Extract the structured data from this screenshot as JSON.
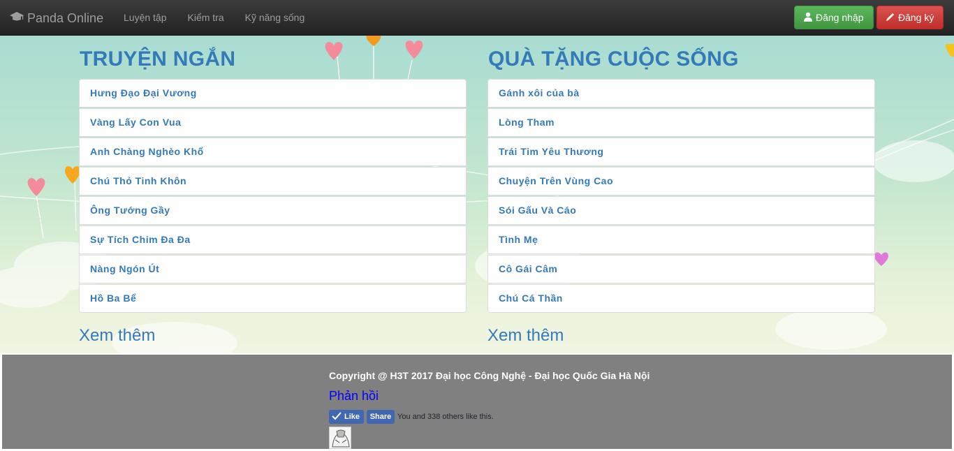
{
  "navbar": {
    "brand": "Panda Online",
    "links": [
      "Luyện tập",
      "Kiểm tra",
      "Kỹ năng sống"
    ],
    "login": "Đăng nhập",
    "register": "Đăng ký"
  },
  "left": {
    "title": "TRUYỆN NGẮN",
    "items": [
      "Hưng Đạo Đại Vương",
      "Vàng Lấy Con Vua",
      "Anh Chàng Nghèo Khổ",
      "Chú Thỏ Tinh Khôn",
      "Ông Tướng Gầy",
      "Sự Tích Chim Đa Đa",
      "Nàng Ngón Út",
      "Hồ Ba Bể"
    ],
    "more": "Xem thêm"
  },
  "right": {
    "title": "QUÀ TẶNG CUỘC SỐNG",
    "items": [
      "Gánh xôi của bà",
      "Lòng Tham",
      "Trái Tim Yêu Thương",
      "Chuyện Trên Vùng Cao",
      "Sói Gấu Và Cáo",
      "Tình Mẹ",
      "Cô Gái Câm",
      "Chú Cá Thần"
    ],
    "more": "Xem thêm"
  },
  "footer": {
    "copyright": "Copyright @ H3T 2017 Đại học Công Nghệ - Đại học Quốc Gia Hà Nội",
    "feedback": "Phản hồi",
    "like": "Like",
    "share": "Share",
    "like_text": "You and 338 others like this."
  },
  "icons": {
    "brand": "graduation-cap-icon",
    "login": "user-icon",
    "register": "pencil-icon",
    "like": "check-icon"
  },
  "colors": {
    "link": "#337ab7",
    "navbar": "#222222",
    "login_button": "#5cb85c",
    "register_button": "#d9534f",
    "footer": "#808080",
    "facebook": "#4267b2"
  }
}
